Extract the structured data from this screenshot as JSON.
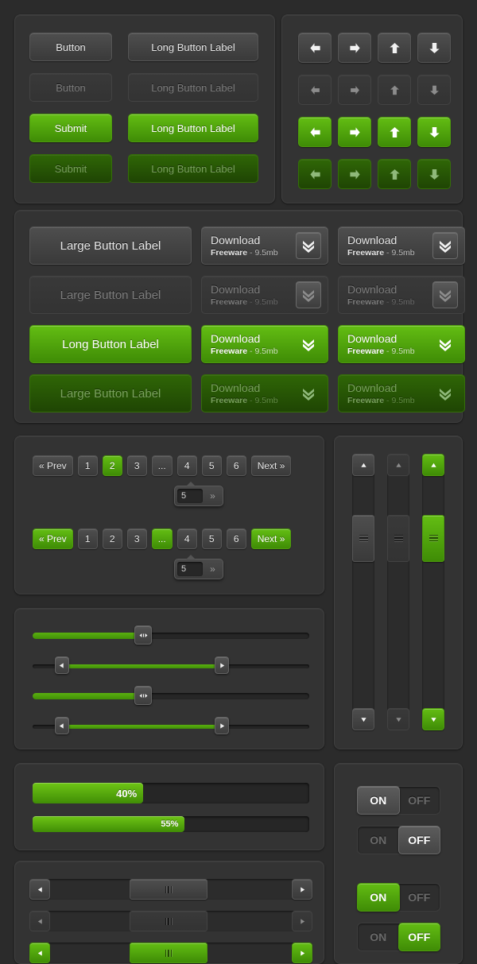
{
  "theme": {
    "page_bg": "#2b2b2b",
    "panel_bg": "#333333",
    "accent_green": "#63bd13",
    "accent_green_dark": "#3f8c06",
    "text_light": "#e8e8e8",
    "text_muted": "#7d7d7d"
  },
  "buttons_panel": {
    "rows": [
      {
        "state": "normal",
        "small_label": "Button",
        "long_label": "Long Button Label"
      },
      {
        "state": "disabled",
        "small_label": "Button",
        "long_label": "Long Button Label"
      },
      {
        "state": "green",
        "small_label": "Submit",
        "long_label": "Long Button Label"
      },
      {
        "state": "green-disabled",
        "small_label": "Submit",
        "long_label": "Long Button Label"
      }
    ]
  },
  "arrows_panel": {
    "directions": [
      "arrow-left",
      "arrow-right",
      "arrow-up",
      "arrow-down"
    ],
    "glyphs": [
      "←",
      "→",
      "↑",
      "↓"
    ],
    "rows": [
      "normal",
      "disabled",
      "green",
      "green-disabled"
    ]
  },
  "large_panel": {
    "rows": [
      {
        "state": "normal",
        "large_label": "Large Button Label",
        "download_title": "Download",
        "download_meta_bold": "Freeware",
        "download_meta_rest": " - 9.5mb",
        "chevron_icon": "double-chevron-down"
      },
      {
        "state": "disabled",
        "large_label": "Large Button Label",
        "download_title": "Download",
        "download_meta_bold": "Freeware",
        "download_meta_rest": " - 9.5mb",
        "chevron_icon": "double-chevron-down"
      },
      {
        "state": "green",
        "large_label": "Long Button Label",
        "download_title": "Download",
        "download_meta_bold": "Freeware",
        "download_meta_rest": " - 9.5mb",
        "chevron_icon": "double-chevron-down"
      },
      {
        "state": "green-disabled",
        "large_label": "Large Button Label",
        "download_title": "Download",
        "download_meta_bold": "Freeware",
        "download_meta_rest": " - 9.5mb",
        "chevron_icon": "double-chevron-down"
      }
    ]
  },
  "pagination_panel": {
    "row_gray": {
      "prev_label": "« Prev",
      "next_label": "Next »",
      "pages": [
        "1",
        "2",
        "3",
        "...",
        "4",
        "5",
        "6"
      ],
      "active_page": "2",
      "ellipsis_index": 3
    },
    "row_green": {
      "prev_label": "« Prev",
      "next_label": "Next »",
      "pages": [
        "1",
        "2",
        "3",
        "...",
        "4",
        "5",
        "6"
      ],
      "active_page": "2",
      "ellipsis_index": 3
    },
    "popover": {
      "page_value": "5",
      "go_label": "»"
    }
  },
  "sliders_panel": {
    "sliders": [
      {
        "type": "single",
        "value_pct": 40,
        "handle_icon": "double-arrow-horizontal"
      },
      {
        "type": "range",
        "start_pct": 12,
        "end_pct": 67,
        "left_handle_icon": "arrow-left",
        "right_handle_icon": "arrow-right"
      },
      {
        "type": "single",
        "value_pct": 40,
        "handle_icon": "double-arrow-horizontal"
      },
      {
        "type": "range",
        "start_pct": 12,
        "end_pct": 67,
        "left_handle_icon": "arrow-left",
        "right_handle_icon": "arrow-right"
      }
    ]
  },
  "progress_panel": {
    "bars": [
      {
        "percent": 40,
        "label": "40%"
      },
      {
        "percent": 55,
        "label": "55%"
      }
    ]
  },
  "hscroll_panel": {
    "bars": [
      {
        "state": "normal",
        "thumb_left_pct": 33,
        "thumb_width_pct": 32,
        "left_icon": "arrow-left",
        "right_icon": "arrow-right",
        "grip_icon": "grip-vertical"
      },
      {
        "state": "disabled",
        "thumb_left_pct": 33,
        "thumb_width_pct": 32,
        "left_icon": "arrow-left",
        "right_icon": "arrow-right",
        "grip_icon": "grip-vertical"
      },
      {
        "state": "green",
        "thumb_left_pct": 33,
        "thumb_width_pct": 32,
        "left_icon": "arrow-left",
        "right_icon": "arrow-right",
        "grip_icon": "grip-vertical"
      }
    ]
  },
  "vscroll_panel": {
    "bars": [
      {
        "state": "normal",
        "thumb_top_pct": 22,
        "thumb_height_pct": 17,
        "up_icon": "arrow-up",
        "down_icon": "arrow-down",
        "grip_icon": "grip-horizontal"
      },
      {
        "state": "disabled",
        "thumb_top_pct": 22,
        "thumb_height_pct": 17,
        "up_icon": "arrow-up",
        "down_icon": "arrow-down",
        "grip_icon": "grip-horizontal"
      },
      {
        "state": "green",
        "thumb_top_pct": 22,
        "thumb_height_pct": 17,
        "up_icon": "arrow-up",
        "down_icon": "arrow-down",
        "grip_icon": "grip-horizontal"
      }
    ]
  },
  "toggles_panel": {
    "on_label": "ON",
    "off_label": "OFF",
    "toggles": [
      {
        "state": "gray",
        "selected": "ON"
      },
      {
        "state": "gray",
        "selected": "OFF"
      },
      {
        "state": "green",
        "selected": "ON"
      },
      {
        "state": "green",
        "selected": "OFF"
      }
    ]
  }
}
